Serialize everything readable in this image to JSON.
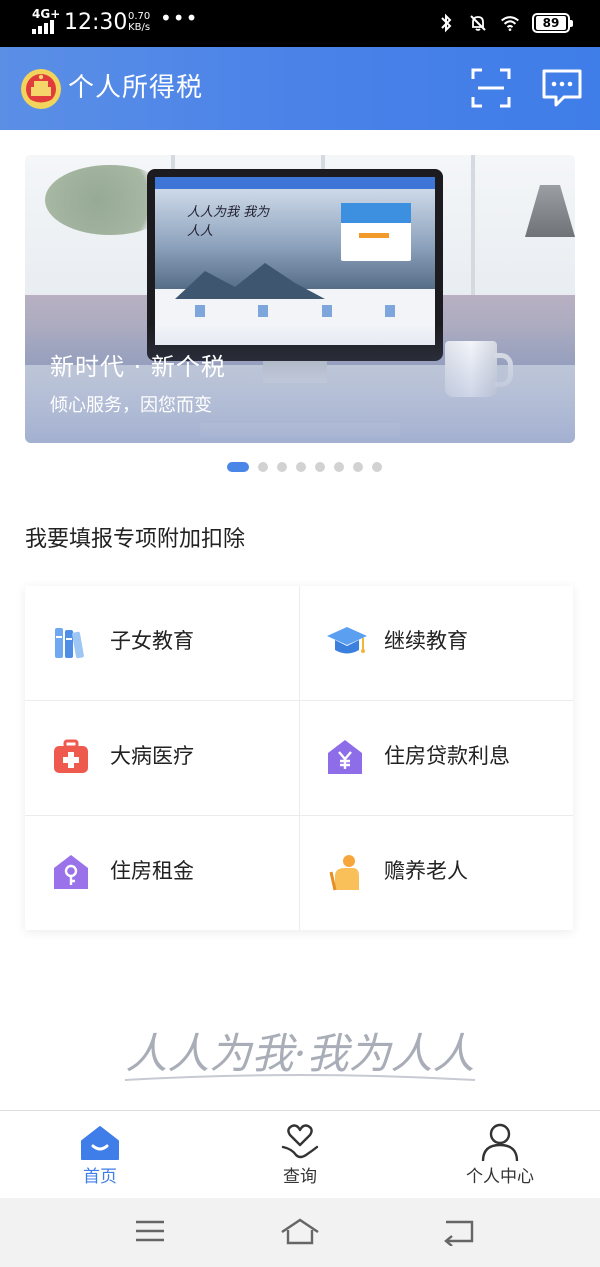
{
  "status_bar": {
    "network": "4G+",
    "time": "12:30",
    "speed_value": "0.70",
    "speed_unit": "KB/s",
    "more": "•••",
    "battery": "89",
    "icons": [
      "signal-icon",
      "bluetooth-icon",
      "mute-icon",
      "wifi-icon",
      "battery-icon"
    ]
  },
  "header": {
    "title": "个人所得税",
    "icons": [
      "emblem-icon",
      "scan-icon",
      "message-icon"
    ]
  },
  "banner": {
    "title": "新时代 · 新个税",
    "subtitle": "倾心服务，因您而变",
    "screen_calligraphy": "人人为我 我为人人",
    "dot_count": 8,
    "active_index": 0
  },
  "section": {
    "title": "我要填报专项附加扣除",
    "items": [
      {
        "label": "子女教育",
        "icon": "books-icon"
      },
      {
        "label": "继续教育",
        "icon": "graduation-cap-icon"
      },
      {
        "label": "大病医疗",
        "icon": "medical-kit-icon"
      },
      {
        "label": "住房贷款利息",
        "icon": "house-yen-icon"
      },
      {
        "label": "住房租金",
        "icon": "house-key-icon"
      },
      {
        "label": "赡养老人",
        "icon": "elderly-icon"
      }
    ]
  },
  "slogan": "人人为我·我为人人",
  "bottom_nav": {
    "items": [
      {
        "label": "首页",
        "icon": "home-icon",
        "active": true
      },
      {
        "label": "查询",
        "icon": "heart-hand-icon",
        "active": false
      },
      {
        "label": "个人中心",
        "icon": "person-icon",
        "active": false
      }
    ]
  },
  "system_nav": {
    "icons": [
      "menu-icon",
      "home-outline-icon",
      "back-icon"
    ]
  },
  "colors": {
    "header_gradient_start": "#5b8fe6",
    "header_gradient_end": "#3f7de8",
    "accent": "#4a86e8",
    "status_bar": "#000000"
  }
}
